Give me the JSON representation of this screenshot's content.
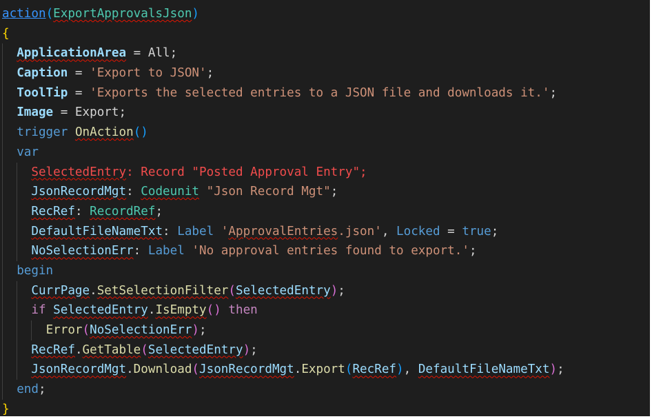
{
  "editor": {
    "language": "AL",
    "theme_background": "#1e1e1e",
    "lines": [
      {
        "indent": 0,
        "tokens": [
          [
            "link",
            "action"
          ],
          [
            "bracket3",
            "("
          ],
          [
            "type",
            "ExportApprovalsJson",
            "sq"
          ],
          [
            "bracket3",
            ")"
          ]
        ]
      },
      {
        "indent": 0,
        "tokens": [
          [
            "yellow",
            "{"
          ]
        ]
      },
      {
        "indent": 2,
        "tokens": [
          [
            "prop",
            "ApplicationArea",
            "sq"
          ],
          [
            "plain",
            " = All;"
          ]
        ]
      },
      {
        "indent": 2,
        "tokens": [
          [
            "prop",
            "Caption"
          ],
          [
            "plain",
            " = "
          ],
          [
            "str",
            "'Export to JSON'"
          ],
          [
            "plain",
            ";"
          ]
        ]
      },
      {
        "indent": 2,
        "tokens": [
          [
            "prop",
            "ToolTip"
          ],
          [
            "plain",
            " = "
          ],
          [
            "str",
            "'Exports the selected entries to a JSON file and downloads it.'"
          ],
          [
            "plain",
            ";"
          ]
        ]
      },
      {
        "indent": 2,
        "tokens": [
          [
            "prop",
            "Image"
          ],
          [
            "plain",
            " = Export;"
          ]
        ]
      },
      {
        "indent": 2,
        "tokens": [
          [
            "kw",
            "trigger "
          ],
          [
            "func",
            "OnAction",
            "sq"
          ],
          [
            "bracket3",
            "()"
          ]
        ]
      },
      {
        "indent": 2,
        "tokens": [
          [
            "kw",
            "var"
          ]
        ]
      },
      {
        "indent": 4,
        "tokens": [
          [
            "err",
            "SelectedEntry",
            "sq"
          ],
          [
            "err",
            ": Record \"Posted Approval Entry\";"
          ]
        ]
      },
      {
        "indent": 4,
        "tokens": [
          [
            "var",
            "JsonRecordMgt",
            "sq"
          ],
          [
            "plain",
            ": "
          ],
          [
            "type",
            "Codeunit",
            "sq"
          ],
          [
            "plain",
            " "
          ],
          [
            "str",
            "\"Json Record Mgt\""
          ],
          [
            "plain",
            ";"
          ]
        ]
      },
      {
        "indent": 4,
        "tokens": [
          [
            "var",
            "RecRef",
            "sq"
          ],
          [
            "plain",
            ": "
          ],
          [
            "type",
            "RecordRef",
            "sq"
          ],
          [
            "plain",
            ";"
          ]
        ]
      },
      {
        "indent": 4,
        "tokens": [
          [
            "var",
            "DefaultFileNameTxt",
            "sq"
          ],
          [
            "plain",
            ": "
          ],
          [
            "kw",
            "Label "
          ],
          [
            "str",
            "'"
          ],
          [
            "str",
            "ApprovalEntries",
            "sq"
          ],
          [
            "str",
            ".json'"
          ],
          [
            "plain",
            ", "
          ],
          [
            "kw",
            "Locked"
          ],
          [
            "plain",
            " = "
          ],
          [
            "kw",
            "true"
          ],
          [
            "plain",
            ";"
          ]
        ]
      },
      {
        "indent": 4,
        "tokens": [
          [
            "var",
            "NoSelectionErr",
            "sq"
          ],
          [
            "plain",
            ": "
          ],
          [
            "kw",
            "Label "
          ],
          [
            "str",
            "'No approval entries found to export.'"
          ],
          [
            "plain",
            ";"
          ]
        ]
      },
      {
        "indent": 2,
        "tokens": [
          [
            "kw",
            "begin"
          ]
        ]
      },
      {
        "indent": 4,
        "tokens": [
          [
            "var",
            "CurrPage",
            "sq"
          ],
          [
            "plain",
            "."
          ],
          [
            "func",
            "SetSelectionFilter",
            "sq"
          ],
          [
            "bracket2",
            "("
          ],
          [
            "var",
            "SelectedEntry",
            "sq"
          ],
          [
            "bracket2",
            ")"
          ],
          [
            "plain",
            ";"
          ]
        ]
      },
      {
        "indent": 4,
        "tokens": [
          [
            "ctrl",
            "if "
          ],
          [
            "var",
            "SelectedEntry",
            "sq"
          ],
          [
            "plain",
            "."
          ],
          [
            "func",
            "IsEmpty",
            "sq"
          ],
          [
            "bracket2",
            "()"
          ],
          [
            "ctrl",
            " then"
          ]
        ]
      },
      {
        "indent": 6,
        "tokens": [
          [
            "func",
            "Error"
          ],
          [
            "bracket2",
            "("
          ],
          [
            "var",
            "NoSelectionErr",
            "sq"
          ],
          [
            "bracket2",
            ")"
          ],
          [
            "plain",
            ";"
          ]
        ]
      },
      {
        "indent": 4,
        "tokens": [
          [
            "var",
            "RecRef",
            "sq"
          ],
          [
            "plain",
            "."
          ],
          [
            "func",
            "GetTable",
            "sq"
          ],
          [
            "bracket2",
            "("
          ],
          [
            "var",
            "SelectedEntry",
            "sq"
          ],
          [
            "bracket2",
            ")"
          ],
          [
            "plain",
            ";"
          ]
        ]
      },
      {
        "indent": 4,
        "tokens": [
          [
            "var",
            "JsonRecordMgt",
            "sq"
          ],
          [
            "plain",
            "."
          ],
          [
            "func",
            "Download"
          ],
          [
            "bracket2",
            "("
          ],
          [
            "var",
            "JsonRecordMgt",
            "sq"
          ],
          [
            "plain",
            "."
          ],
          [
            "func",
            "Export"
          ],
          [
            "bracket3",
            "("
          ],
          [
            "var",
            "RecRef",
            "sq"
          ],
          [
            "bracket3",
            ")"
          ],
          [
            "plain",
            ", "
          ],
          [
            "var",
            "DefaultFileNameTxt",
            "sq"
          ],
          [
            "bracket2",
            ")"
          ],
          [
            "plain",
            ";"
          ]
        ]
      },
      {
        "indent": 2,
        "tokens": [
          [
            "kw",
            "end"
          ],
          [
            "plain",
            ";"
          ]
        ]
      },
      {
        "indent": 0,
        "tokens": [
          [
            "yellow",
            "}"
          ]
        ]
      }
    ]
  }
}
